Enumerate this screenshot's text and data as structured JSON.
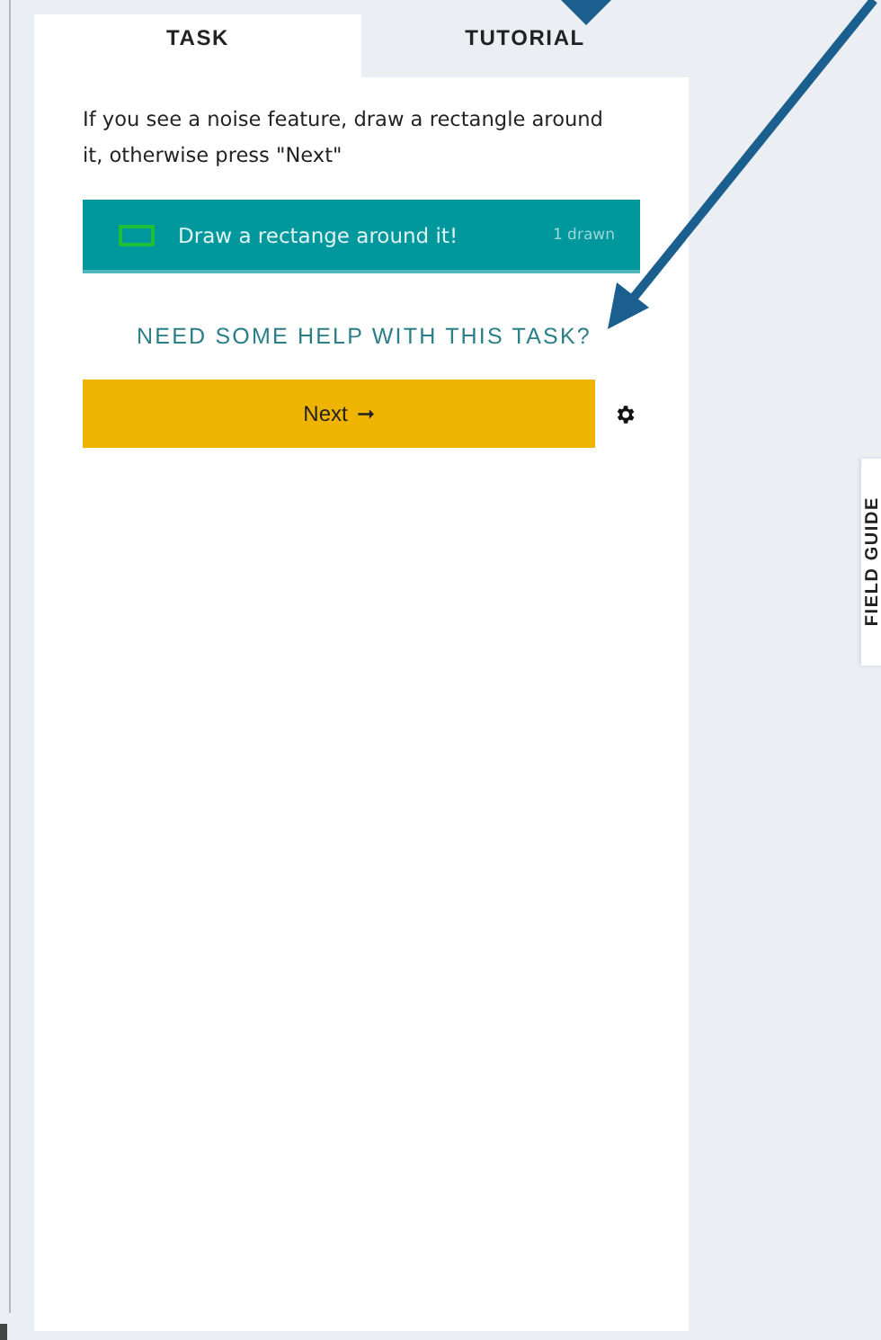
{
  "tabs": [
    {
      "label": "TASK",
      "selected": true
    },
    {
      "label": "TUTORIAL",
      "selected": false
    }
  ],
  "instruction": "If you see a noise feature, draw a rectangle around it, otherwise press \"Next\"",
  "tool": {
    "label": "Draw a rectange around it!",
    "count": "1 drawn",
    "color": "#1fbf3a"
  },
  "help_link": "NEED SOME HELP WITH THIS TASK?",
  "next_button": {
    "label": "Next",
    "arrow": "➞"
  },
  "field_guide_tab": "FIELD GUIDE"
}
